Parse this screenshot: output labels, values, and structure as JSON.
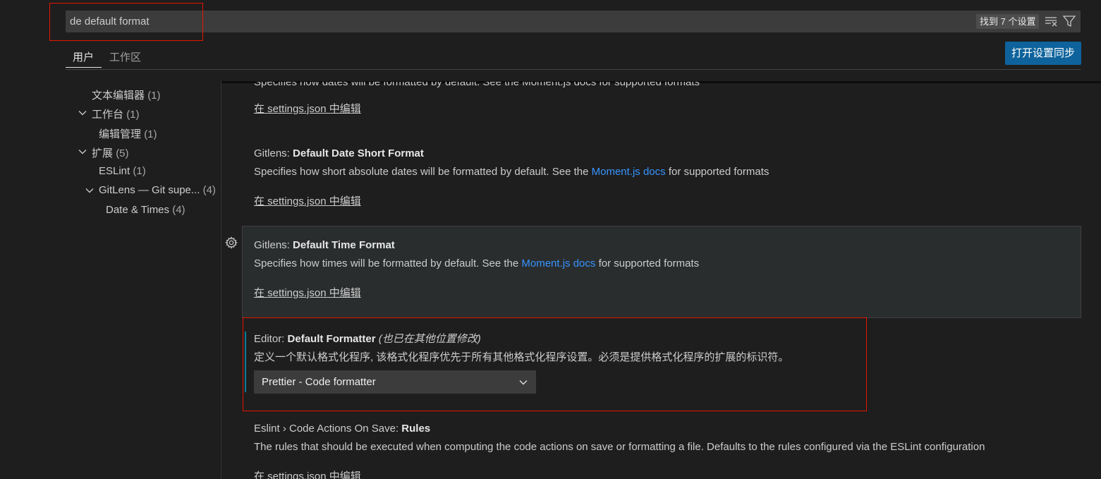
{
  "search": {
    "query": "de default format",
    "result_count": "找到 7 个设置"
  },
  "tabs": {
    "user": "用户",
    "workspace": "工作区"
  },
  "sync_button": "打开设置同步",
  "tree": {
    "text_editor": "文本编辑器",
    "text_editor_count": "(1)",
    "workbench": "工作台",
    "workbench_count": "(1)",
    "editor_management": "编辑管理",
    "editor_management_count": "(1)",
    "extensions": "扩展",
    "extensions_count": "(5)",
    "eslint": "ESLint",
    "eslint_count": "(1)",
    "gitlens": "GitLens — Git supe...",
    "gitlens_count": "(4)",
    "date_times": "Date & Times",
    "date_times_count": "(4)"
  },
  "settings": {
    "edit_in_json": "在 settings.json 中编辑",
    "cut_off_text": "Specifies how dates will be formatted by default. See the Moment.js docs for supported formats",
    "date_short": {
      "prefix": "Gitlens: ",
      "name": "Default Date Short Format",
      "desc_before": "Specifies how short absolute dates will be formatted by default. See the ",
      "link": "Moment.js docs",
      "desc_after": " for supported formats"
    },
    "time_format": {
      "prefix": "Gitlens: ",
      "name": "Default Time Format",
      "desc_before": "Specifies how times will be formatted by default. See the ",
      "link": "Moment.js docs",
      "desc_after": " for supported formats"
    },
    "default_formatter": {
      "prefix": "Editor: ",
      "name": "Default Formatter",
      "modified_note": "(也已在其他位置修改)",
      "description": "定义一个默认格式化程序, 该格式化程序优先于所有其他格式化程序设置。必须是提供格式化程序的扩展的标识符。",
      "value": "Prettier - Code formatter"
    },
    "eslint_rules": {
      "prefix": "Eslint › Code Actions On Save: ",
      "name": "Rules",
      "description": "The rules that should be executed when computing the code actions on save or formatting a file. Defaults to the rules configured via the ESLint configuration"
    }
  },
  "colors": {
    "background": "#1e1e1e",
    "accent_button": "#0e639c",
    "link": "#3794ff",
    "highlight_border": "#e51400",
    "modified_indicator": "#0c7d9d"
  },
  "icons": [
    "clear-filter-icon",
    "filter-icon",
    "chevron-down-icon",
    "gear-icon"
  ]
}
